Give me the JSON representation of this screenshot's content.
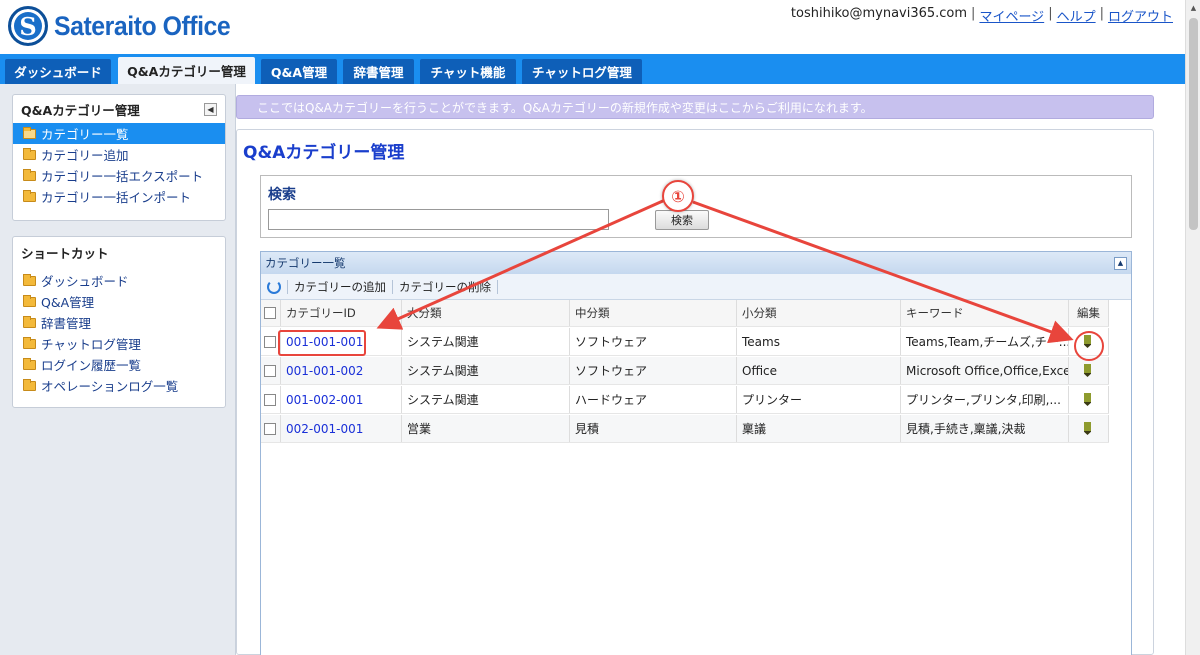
{
  "logo": {
    "mark": "S",
    "text": "Sateraito Office"
  },
  "user": {
    "email": "toshihiko@mynavi365.com",
    "links": [
      "マイページ",
      "ヘルプ",
      "ログアウト"
    ]
  },
  "nav": {
    "tabs": [
      "ダッシュボード",
      "Q&Aカテゴリー管理",
      "Q&A管理",
      "辞書管理",
      "チャット機能",
      "チャットログ管理"
    ],
    "active": "Q&Aカテゴリー管理"
  },
  "sidebar": {
    "section1": {
      "title": "Q&Aカテゴリー管理",
      "collapse": "◀",
      "items": [
        "カテゴリー一覧",
        "カテゴリー追加",
        "カテゴリー一括エクスポート",
        "カテゴリー一括インポート"
      ]
    },
    "section2": {
      "title": "ショートカット",
      "items": [
        "ダッシュボード",
        "Q&A管理",
        "辞書管理",
        "チャットログ管理",
        "ログイン履歴一覧",
        "オペレーションログ一覧"
      ]
    }
  },
  "info": "ここではQ&Aカテゴリーを行うことができます。Q&Aカテゴリーの新規作成や変更はここからご利用になれます。",
  "main": {
    "title": "Q&Aカテゴリー管理",
    "search": {
      "title": "検索",
      "button": "検索",
      "value": ""
    },
    "grid": {
      "title": "カテゴリー一覧",
      "collapse": "▲",
      "toolbar": [
        "カテゴリーの追加",
        "カテゴリーの削除"
      ],
      "columns": [
        "カテゴリーID",
        "大分類",
        "中分類",
        "小分類",
        "キーワード",
        "編集"
      ],
      "rows": [
        [
          "001-001-001",
          "システム関連",
          "ソフトウェア",
          "Teams",
          "Teams,Team,チームズ,チー..."
        ],
        [
          "001-001-002",
          "システム関連",
          "ソフトウェア",
          "Office",
          "Microsoft Office,Office,Excel,..."
        ],
        [
          "001-002-001",
          "システム関連",
          "ハードウェア",
          "プリンター",
          "プリンター,プリンタ,印刷,..."
        ],
        [
          "002-001-001",
          "営業",
          "見積",
          "稟議",
          "見積,手続き,稟議,決裁"
        ]
      ]
    }
  },
  "annotation": {
    "badge": "①"
  },
  "colors": {
    "nav": "#1a8ef0",
    "tab": "#0e5fb8",
    "link": "#1a30d8",
    "annotation": "#e8453c"
  }
}
